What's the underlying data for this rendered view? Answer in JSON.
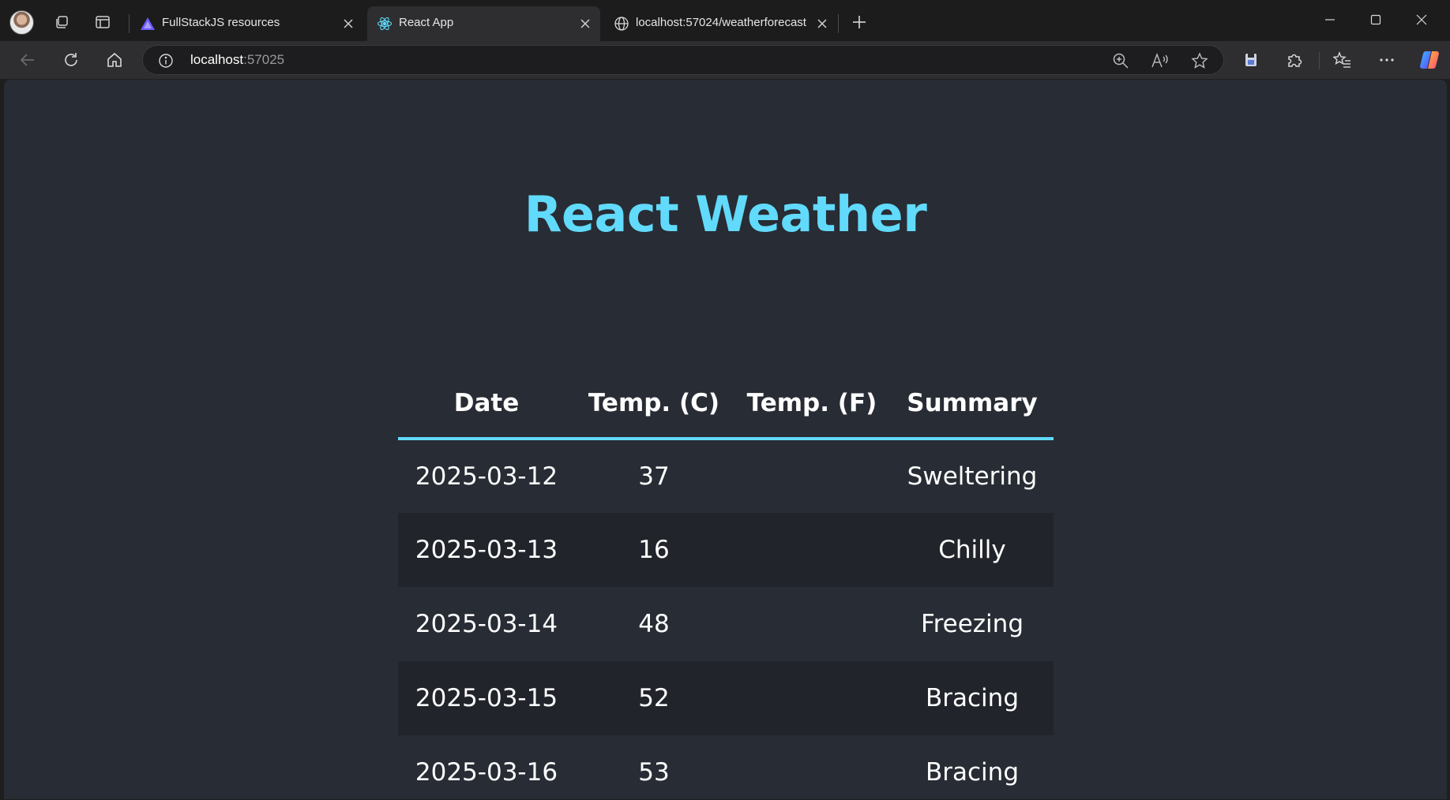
{
  "browser": {
    "tabs": [
      {
        "title": "FullStackJS resources",
        "favicon": "triangle-logo-icon",
        "active": false
      },
      {
        "title": "React App",
        "favicon": "react-logo-icon",
        "active": true
      },
      {
        "title": "localhost:57024/weatherforecast",
        "favicon": "globe-icon",
        "active": false
      }
    ],
    "address": {
      "host": "localhost",
      "port": ":57025"
    }
  },
  "page": {
    "title": "React Weather",
    "columns": [
      "Date",
      "Temp. (C)",
      "Temp. (F)",
      "Summary"
    ],
    "rows": [
      {
        "date": "2025-03-12",
        "tempC": "37",
        "tempF": "",
        "summary": "Sweltering"
      },
      {
        "date": "2025-03-13",
        "tempC": "16",
        "tempF": "",
        "summary": "Chilly"
      },
      {
        "date": "2025-03-14",
        "tempC": "48",
        "tempF": "",
        "summary": "Freezing"
      },
      {
        "date": "2025-03-15",
        "tempC": "52",
        "tempF": "",
        "summary": "Bracing"
      },
      {
        "date": "2025-03-16",
        "tempC": "53",
        "tempF": "",
        "summary": "Bracing"
      }
    ]
  },
  "colors": {
    "accent": "#61dafb",
    "page_background": "#282c34",
    "row_alt_background": "#21242b"
  }
}
